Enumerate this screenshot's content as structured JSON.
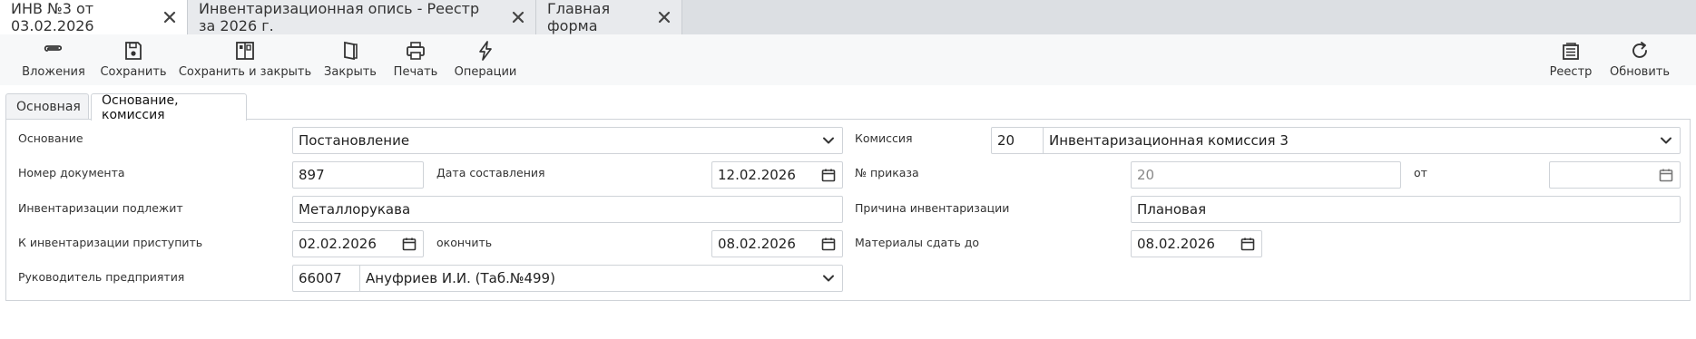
{
  "doc_tabs": [
    {
      "label": "ИНВ №3 от 03.02.2026"
    },
    {
      "label": "Инвентаризационная опись - Реестр за 2026 г."
    },
    {
      "label": "Главная форма"
    }
  ],
  "toolbar": {
    "attachments": "Вложения",
    "save": "Сохранить",
    "save_close": "Сохранить и закрыть",
    "close": "Закрыть",
    "print": "Печать",
    "operations": "Операции",
    "registry": "Реестр",
    "refresh": "Обновить"
  },
  "section_tabs": [
    {
      "label": "Основная"
    },
    {
      "label": "Основание, комиссия"
    }
  ],
  "form": {
    "basis_label": "Основание",
    "basis_value": "Постановление",
    "doc_number_label": "Номер документа",
    "doc_number_value": "897",
    "date_compiled_label": "Дата составления",
    "date_compiled_value": "12.02.2026",
    "subject_label": "Инвентаризации подлежит",
    "subject_value": "Металлорукава",
    "start_label": "К инвентаризации приступить",
    "start_value": "02.02.2026",
    "end_label": "окончить",
    "end_value": "08.02.2026",
    "head_label": "Руководитель предприятия",
    "head_code": "66007",
    "head_value": "Ануфриев И.И. (Таб.№499)",
    "commission_label": "Комиссия",
    "commission_code": "20",
    "commission_value": "Инвентаризационная комиссия 3",
    "order_label": "№ приказа",
    "order_placeholder": "20",
    "order_from_label": "от",
    "reason_label": "Причина инвентаризации",
    "reason_value": "Плановая",
    "materials_label": "Материалы сдать до",
    "materials_value": "08.02.2026"
  }
}
